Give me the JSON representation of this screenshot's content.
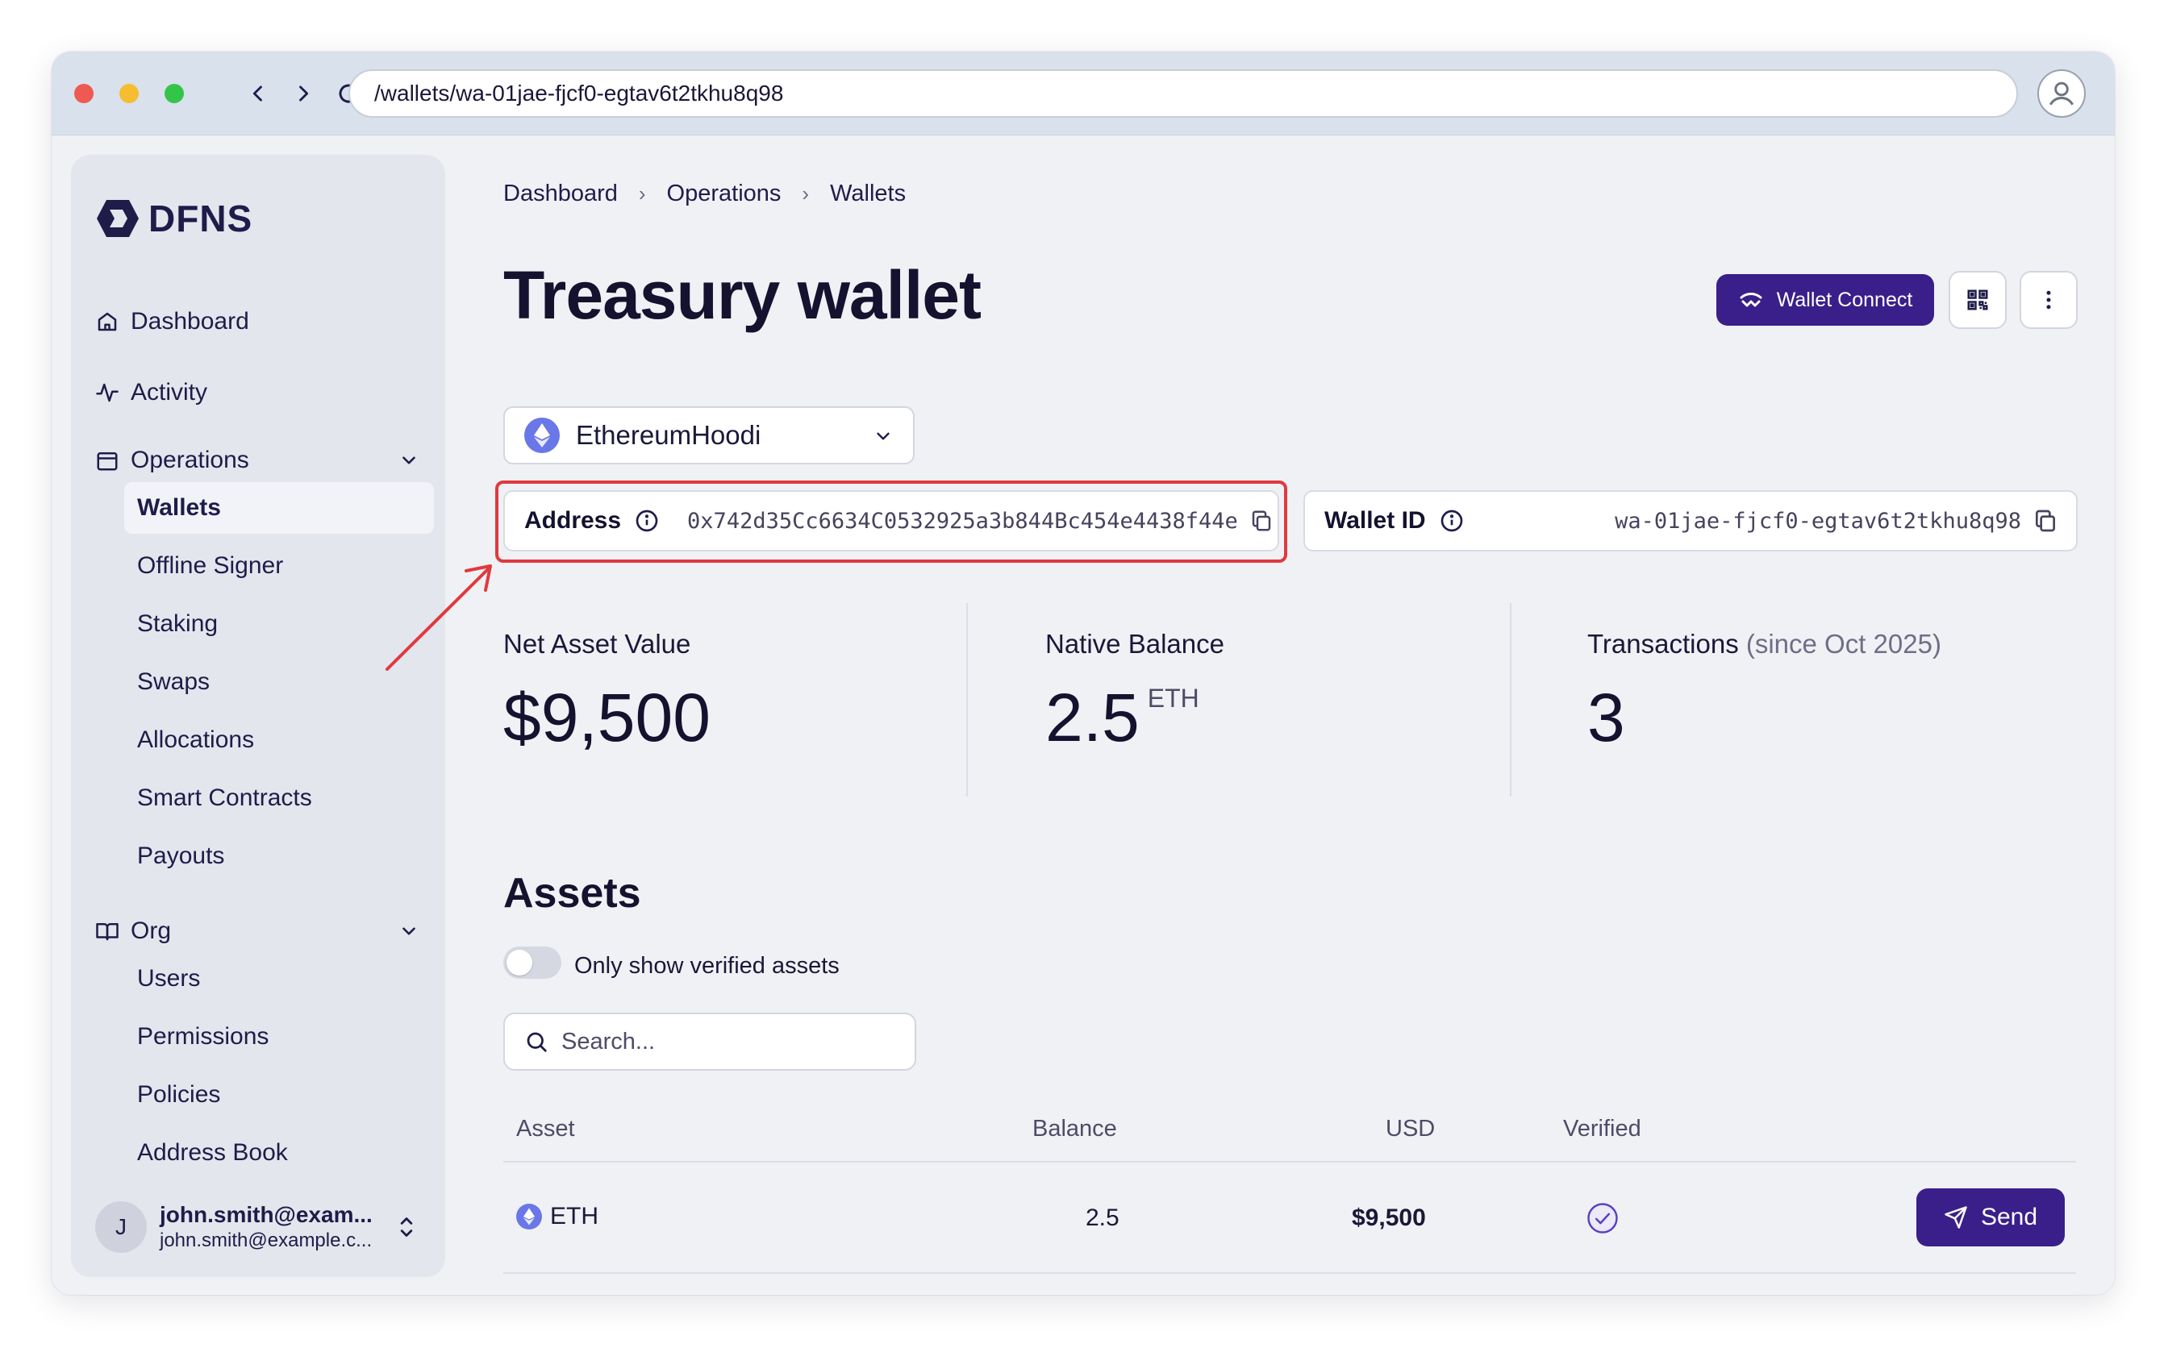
{
  "browser": {
    "url": "/wallets/wa-01jae-fjcf0-egtav6t2tkhu8q98"
  },
  "sidebar": {
    "brand": "DFNS",
    "top_items": [
      {
        "label": "Dashboard",
        "icon": "home-icon"
      },
      {
        "label": "Activity",
        "icon": "activity-icon"
      },
      {
        "label": "Operations",
        "icon": "calendar-icon"
      },
      {
        "label": "Org",
        "icon": "book-icon"
      }
    ],
    "operations_items": [
      "Wallets",
      "Offline Signer",
      "Staking",
      "Swaps",
      "Allocations",
      "Smart Contracts",
      "Payouts"
    ],
    "org_items": [
      "Users",
      "Permissions",
      "Policies",
      "Address Book"
    ],
    "active_item": "Wallets",
    "user": {
      "initial": "J",
      "name": "john.smith@exam...",
      "email": "john.smith@example.c..."
    }
  },
  "breadcrumbs": [
    "Dashboard",
    "Operations",
    "Wallets"
  ],
  "page_title": "Treasury wallet",
  "header_actions": {
    "wallet_connect_label": "Wallet Connect",
    "icons": [
      "qr-code-icon",
      "more-vertical-icon"
    ]
  },
  "network": {
    "selected": "EthereumHoodi",
    "icon": "ethereum-icon"
  },
  "address_field": {
    "label": "Address",
    "value": "0x742d35Cc6634C0532925a3b844Bc454e4438f44e"
  },
  "wallet_id_field": {
    "label": "Wallet ID",
    "value": "wa-01jae-fjcf0-egtav6t2tkhu8q98"
  },
  "stats": {
    "nav_label": "Net Asset Value",
    "nav_value": "$9,500",
    "native_label": "Native Balance",
    "native_value": "2.5",
    "native_unit": "ETH",
    "tx_label": "Transactions",
    "tx_since": "(since Oct 2025)",
    "tx_value": "3"
  },
  "assets": {
    "title": "Assets",
    "toggle_label": "Only show verified assets",
    "toggle_on": false,
    "search_placeholder": "Search...",
    "columns": [
      "Asset",
      "Balance",
      "USD",
      "Verified"
    ],
    "rows": [
      {
        "asset": "ETH",
        "balance": "2.5",
        "usd": "$9,500",
        "verified": true,
        "action": "Send"
      }
    ]
  },
  "colors": {
    "accent": "#3a1f8a",
    "highlight": "#e0393e",
    "background": "#f0f1f5",
    "sidebar": "#e4e6ed"
  }
}
